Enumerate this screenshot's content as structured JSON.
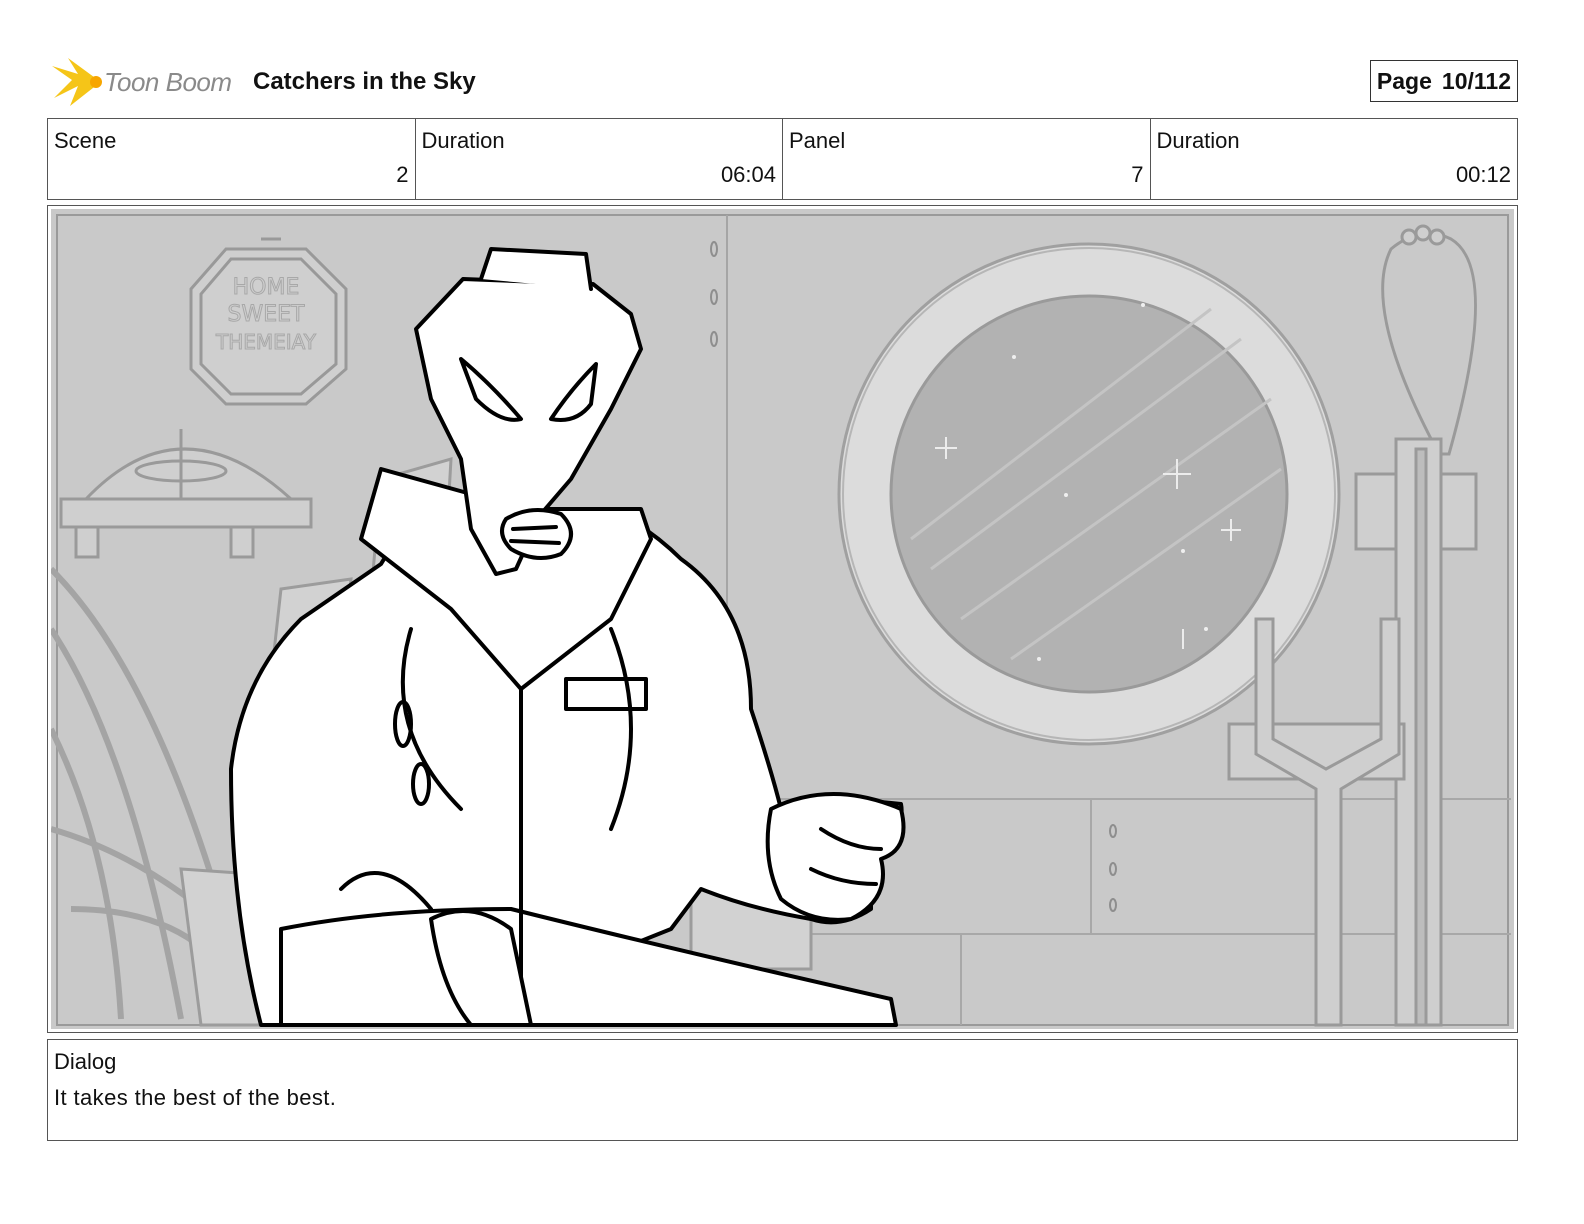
{
  "header": {
    "logo_text": "Toon Boom",
    "project_title": "Catchers in the Sky",
    "page_label": "Page",
    "page_number": "10/112"
  },
  "info": {
    "scene_label": "Scene",
    "scene_value": "2",
    "scene_duration_label": "Duration",
    "scene_duration_value": "06:04",
    "panel_label": "Panel",
    "panel_value": "7",
    "panel_duration_label": "Duration",
    "panel_duration_value": "00:12"
  },
  "panel_sign": [
    "HOME",
    "SWEET",
    "THEMEIAY"
  ],
  "dialog": {
    "label": "Dialog",
    "text": "It takes the best of the best."
  },
  "colors": {
    "background_gray": "#c9c9c9",
    "logo_yellow": "#f5c518",
    "border": "#555555"
  }
}
